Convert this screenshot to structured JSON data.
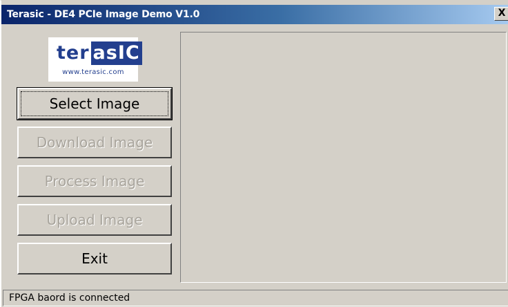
{
  "window": {
    "title": "Terasic - DE4 PCIe Image Demo V1.0",
    "close_label": "X"
  },
  "logo": {
    "word_ter": "ter",
    "word_asic": "asIC",
    "url": "www.terasic.com"
  },
  "buttons": {
    "select_image": "Select Image",
    "download_image": "Download Image",
    "process_image": "Process Image",
    "upload_image": "Upload Image",
    "exit": "Exit"
  },
  "button_states": {
    "select_image": "enabled-default",
    "download_image": "disabled",
    "process_image": "disabled",
    "upload_image": "disabled",
    "exit": "enabled"
  },
  "status": {
    "text": "FPGA baord is connected"
  },
  "colors": {
    "title_gradient_start": "#0a246a",
    "title_gradient_end": "#a6caf0",
    "window_face": "#d4d0c8",
    "logo_brand": "#233f8e",
    "disabled_text": "#a8a49c"
  }
}
